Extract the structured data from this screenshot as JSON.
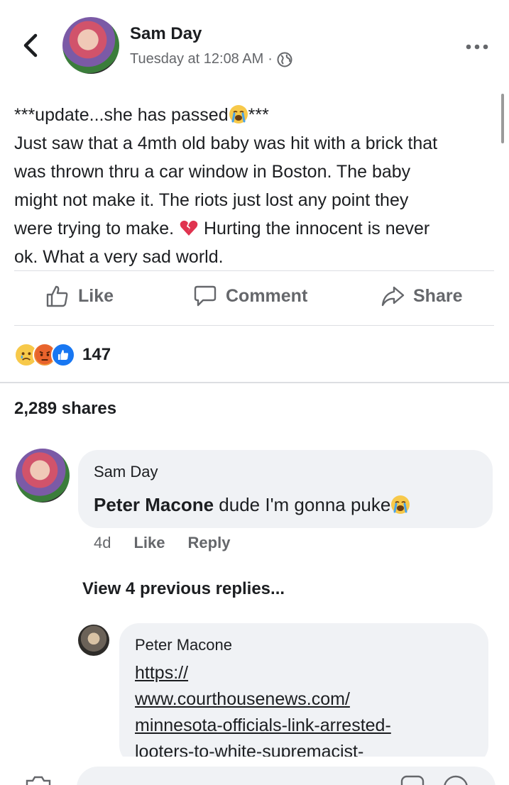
{
  "header": {
    "back_icon": "chevron-left-icon",
    "author": "Sam Day",
    "timestamp": "Tuesday at 12:08 AM",
    "separator": "·",
    "privacy_icon": "globe-icon",
    "more_icon": "more-horizontal-icon"
  },
  "post": {
    "line1_a": "***update...she has passed",
    "line1_b": "***",
    "line2": "Just saw that a 4mth old baby was hit with a brick that",
    "line3": "was thrown thru a car window in Boston. The baby",
    "line4": "might not make it. The riots just lost any point they",
    "line5_a": "were trying to make.",
    "line5_b": "Hurting the innocent is never",
    "line6": "ok. What a very sad world."
  },
  "actions": {
    "like": "Like",
    "comment": "Comment",
    "share": "Share"
  },
  "reactions": {
    "count": "147",
    "types": [
      "sad",
      "angry",
      "like"
    ]
  },
  "shares": "2,289 shares",
  "comment": {
    "author": "Sam Day",
    "mention": "Peter Macone",
    "text": " dude I'm gonna puke",
    "time": "4d",
    "like": "Like",
    "reply": "Reply"
  },
  "view_replies": "View 4 previous replies...",
  "reply": {
    "author": "Peter Macone",
    "link_lines": [
      "https://",
      "www.courthousenews.com/",
      "minnesota-officials-link-arrested-",
      "looters-to-white-supremacist-"
    ]
  },
  "colors": {
    "text": "#1c1e21",
    "secondary": "#65676b",
    "bubble": "#f0f2f5",
    "divider": "#dcdee2",
    "brand_blue": "#1877f2"
  }
}
